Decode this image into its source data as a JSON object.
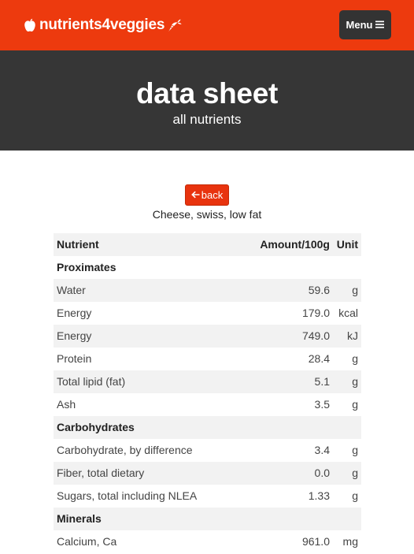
{
  "nav": {
    "brand": "nutrients4veggies",
    "menu_label": "Menu",
    "brand_color": "#ed3a0e"
  },
  "hero": {
    "title": "data sheet",
    "subtitle": "all nutrients"
  },
  "back_label": "back",
  "food_name": "Cheese, swiss, low fat",
  "table": {
    "headers": [
      "Nutrient",
      "Amount/100g",
      "Unit"
    ],
    "rows": [
      {
        "type": "group",
        "name": "Proximates"
      },
      {
        "type": "item",
        "name": "Water",
        "amount": "59.6",
        "unit": "g"
      },
      {
        "type": "item",
        "name": "Energy",
        "amount": "179.0",
        "unit": "kcal"
      },
      {
        "type": "item",
        "name": "Energy",
        "amount": "749.0",
        "unit": "kJ"
      },
      {
        "type": "item",
        "name": "Protein",
        "amount": "28.4",
        "unit": "g"
      },
      {
        "type": "item",
        "name": "Total lipid (fat)",
        "amount": "5.1",
        "unit": "g"
      },
      {
        "type": "item",
        "name": "Ash",
        "amount": "3.5",
        "unit": "g"
      },
      {
        "type": "group",
        "name": "Carbohydrates"
      },
      {
        "type": "item",
        "name": "Carbohydrate, by difference",
        "amount": "3.4",
        "unit": "g"
      },
      {
        "type": "item",
        "name": "Fiber, total dietary",
        "amount": "0.0",
        "unit": "g"
      },
      {
        "type": "item",
        "name": "Sugars, total including NLEA",
        "amount": "1.33",
        "unit": "g"
      },
      {
        "type": "group",
        "name": "Minerals"
      },
      {
        "type": "item",
        "name": "Calcium, Ca",
        "amount": "961.0",
        "unit": "mg"
      }
    ]
  }
}
